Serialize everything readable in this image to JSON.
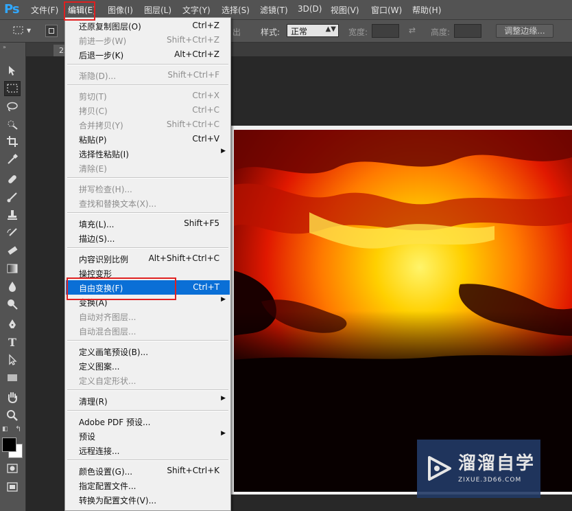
{
  "app": {
    "logo": "Ps"
  },
  "menubar": [
    {
      "label": "文件(F)"
    },
    {
      "label": "编辑(E)"
    },
    {
      "label": "图像(I)"
    },
    {
      "label": "图层(L)"
    },
    {
      "label": "文字(Y)"
    },
    {
      "label": "选择(S)"
    },
    {
      "label": "滤镜(T)"
    },
    {
      "label": "3D(D)"
    },
    {
      "label": "视图(V)"
    },
    {
      "label": "窗口(W)"
    },
    {
      "label": "帮助(H)"
    }
  ],
  "options": {
    "partial_label": "出",
    "style_label": "样式:",
    "style_value": "正常",
    "width_label": "宽度:",
    "height_label": "高度:",
    "refine_edge": "调整边缘..."
  },
  "document": {
    "tab": "22536420"
  },
  "edit_menu": {
    "items": [
      {
        "label": "还原复制图层(O)",
        "shortcut": "Ctrl+Z"
      },
      {
        "label": "前进一步(W)",
        "shortcut": "Shift+Ctrl+Z"
      },
      {
        "label": "后退一步(K)",
        "shortcut": "Alt+Ctrl+Z"
      },
      {
        "label": "渐隐(D)...",
        "shortcut": "Shift+Ctrl+F"
      },
      {
        "label": "剪切(T)",
        "shortcut": "Ctrl+X"
      },
      {
        "label": "拷贝(C)",
        "shortcut": "Ctrl+C"
      },
      {
        "label": "合并拷贝(Y)",
        "shortcut": "Shift+Ctrl+C"
      },
      {
        "label": "粘贴(P)",
        "shortcut": "Ctrl+V"
      },
      {
        "label": "选择性粘贴(I)",
        "shortcut": ""
      },
      {
        "label": "清除(E)",
        "shortcut": ""
      },
      {
        "label": "拼写检查(H)...",
        "shortcut": ""
      },
      {
        "label": "查找和替换文本(X)...",
        "shortcut": ""
      },
      {
        "label": "填充(L)...",
        "shortcut": "Shift+F5"
      },
      {
        "label": "描边(S)...",
        "shortcut": ""
      },
      {
        "label": "内容识别比例",
        "shortcut": "Alt+Shift+Ctrl+C"
      },
      {
        "label": "操控变形",
        "shortcut": ""
      },
      {
        "label": "自由变换(F)",
        "shortcut": "Ctrl+T"
      },
      {
        "label": "变换(A)",
        "shortcut": ""
      },
      {
        "label": "自动对齐图层...",
        "shortcut": ""
      },
      {
        "label": "自动混合图层...",
        "shortcut": ""
      },
      {
        "label": "定义画笔预设(B)...",
        "shortcut": ""
      },
      {
        "label": "定义图案...",
        "shortcut": ""
      },
      {
        "label": "定义自定形状...",
        "shortcut": ""
      },
      {
        "label": "清理(R)",
        "shortcut": ""
      },
      {
        "label": "Adobe PDF 预设...",
        "shortcut": ""
      },
      {
        "label": "预设",
        "shortcut": ""
      },
      {
        "label": "远程连接...",
        "shortcut": ""
      },
      {
        "label": "颜色设置(G)...",
        "shortcut": "Shift+Ctrl+K"
      },
      {
        "label": "指定配置文件...",
        "shortcut": ""
      },
      {
        "label": "转换为配置文件(V)...",
        "shortcut": ""
      }
    ]
  },
  "watermark": {
    "title": "溜溜自学",
    "subtitle": "ZIXUE.3D66.COM"
  },
  "colors": {
    "highlight": "#0a6fd6",
    "annotation_red": "#e02020",
    "ps_blue": "#31a8ff"
  }
}
